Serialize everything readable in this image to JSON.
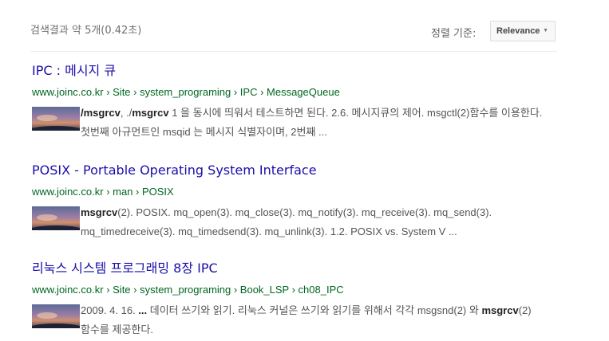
{
  "header": {
    "result_stats": "검색결과 약 5개(0.42초)",
    "sort_label": "정렬 기준:",
    "sort_value": "Relevance",
    "sort_caret_icon": "caret-down-icon"
  },
  "results": [
    {
      "title": "IPC : 메시지 큐",
      "url": "www.joinc.co.kr › Site › system_programing › IPC › MessageQueue",
      "thumbnail_icon": "sunset-thumbnail",
      "snippet": {
        "b1": "/msgrcv",
        "t1": ", ./",
        "b2": "msgrcv",
        "t2": " 1 을 동시에 띄워서 테스트하면 된다. 2.6. 메시지큐의 제어. msgctl(2)함수를 이용한다. 첫번째 아규먼트인 msqid 는 메시지 식별자이며, 2번째 ..."
      }
    },
    {
      "title": "POSIX - Portable Operating System Interface",
      "url": "www.joinc.co.kr › man › POSIX",
      "thumbnail_icon": "sunset-thumbnail",
      "snippet": {
        "b1": "msgrcv",
        "t1": "(2). POSIX. mq_open(3). mq_close(3). mq_notify(3). mq_receive(3). mq_send(3). mq_timedreceive(3). mq_timedsend(3). mq_unlink(3). 1.2. POSIX vs. System V ...",
        "b2": "",
        "t2": ""
      }
    },
    {
      "title": "리눅스 시스템 프로그래밍 8장 IPC",
      "url": "www.joinc.co.kr › Site › system_programing › Book_LSP › ch08_IPC",
      "thumbnail_icon": "sunset-thumbnail",
      "snippet": {
        "b1": "",
        "t1": "2009. 4. 16. ",
        "b2": "...",
        "t2": " 데이터 쓰기와 읽기. 리눅스 커널은 쓰기와 읽기를 위해서 각각 msgsnd(2) 와 ",
        "b3": "msgrcv",
        "t3": "(2) 함수를 제공한다."
      }
    }
  ]
}
